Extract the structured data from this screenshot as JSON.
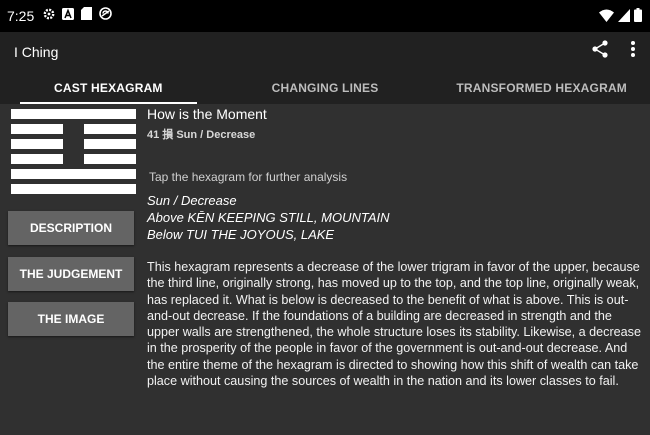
{
  "status_bar": {
    "time": "7:25",
    "left_icons": [
      "settings-icon",
      "a-notification-icon",
      "sd-card-icon",
      "sync-icon"
    ],
    "right_icons": [
      "wifi-icon",
      "signal-icon",
      "battery-icon"
    ]
  },
  "app_bar": {
    "title": "I Ching",
    "actions": [
      "share-icon",
      "more-vert-icon"
    ]
  },
  "tabs": [
    {
      "label": "CAST HEXAGRAM",
      "active": true
    },
    {
      "label": "CHANGING LINES",
      "active": false
    },
    {
      "label": "TRANSFORMED HEXAGRAM",
      "active": false
    }
  ],
  "hexagram": {
    "lines_top_to_bottom": [
      "solid",
      "broken",
      "broken",
      "broken",
      "solid",
      "solid"
    ]
  },
  "buttons": {
    "description": "DESCRIPTION",
    "judgement": "THE JUDGEMENT",
    "image": "THE IMAGE"
  },
  "main": {
    "title": "How is the Moment",
    "subtitle": "41 損 Sun / Decrease",
    "hint": "Tap the hexagram for further analysis",
    "trigram_name": "Sun / Decrease",
    "above": "Above KĒN KEEPING STILL, MOUNTAIN",
    "below": "Below TUI THE JOYOUS, LAKE",
    "description": "This hexagram represents a decrease of the lower trigram in favor of the upper, because the third line, originally strong, has moved up to the top, and the top line, originally weak, has replaced it. What is below is decreased to the benefit of what is above. This is out-and-out decrease. If the foundations of a building are decreased in strength and the upper walls are strengthened, the whole structure loses its stability. Likewise, a decrease in the prosperity of the people in favor of the government is out-and-out decrease. And the entire theme of the hexagram is directed to showing how this shift of wealth can take place without causing the sources of wealth in the nation and its lower classes to fail."
  },
  "colors": {
    "background": "#303030",
    "toolbar": "#212121",
    "button": "#646464",
    "text": "#ffffff"
  }
}
